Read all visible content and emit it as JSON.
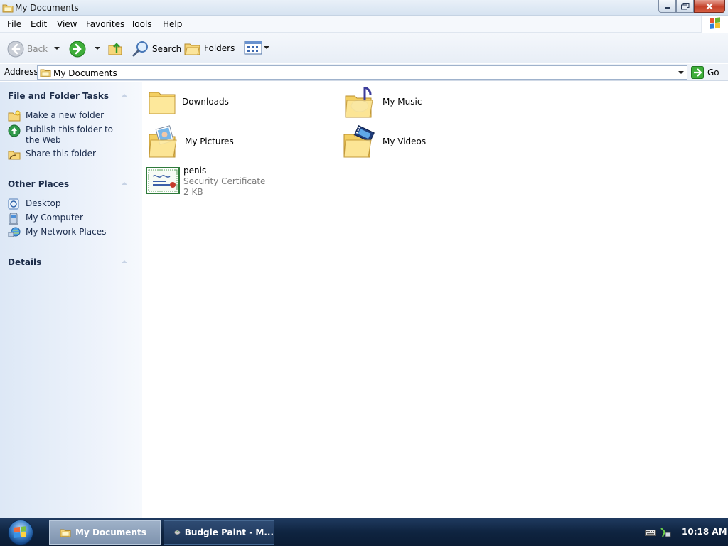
{
  "window": {
    "title": "My Documents"
  },
  "menu": {
    "items": [
      "File",
      "Edit",
      "View",
      "Favorites",
      "Tools",
      "Help"
    ]
  },
  "toolbar": {
    "back_label": "Back",
    "search_label": "Search",
    "folders_label": "Folders"
  },
  "address": {
    "label": "Address",
    "value": "My Documents",
    "go_label": "Go"
  },
  "taskpane": {
    "file_tasks": {
      "title": "File and Folder Tasks",
      "items": [
        "Make a new folder",
        "Publish this folder to the Web",
        "Share this folder"
      ]
    },
    "other_places": {
      "title": "Other Places",
      "items": [
        "Desktop",
        "My Computer",
        "My Network Places"
      ]
    },
    "details": {
      "title": "Details"
    }
  },
  "content": {
    "items": [
      {
        "name": "Downloads"
      },
      {
        "name": "My Music"
      },
      {
        "name": "My Pictures"
      },
      {
        "name": "My Videos"
      },
      {
        "name": "penis",
        "type": "Security Certificate",
        "size": "2 KB"
      }
    ]
  },
  "taskbar": {
    "tasks": [
      {
        "label": "My Documents",
        "active": true
      },
      {
        "label": "Budgie Paint - M...",
        "active": false
      }
    ],
    "clock": "10:18 AM"
  },
  "colors": {
    "accent": "#316ac5",
    "taskbar": "#0f2440",
    "close": "#c5422b"
  }
}
